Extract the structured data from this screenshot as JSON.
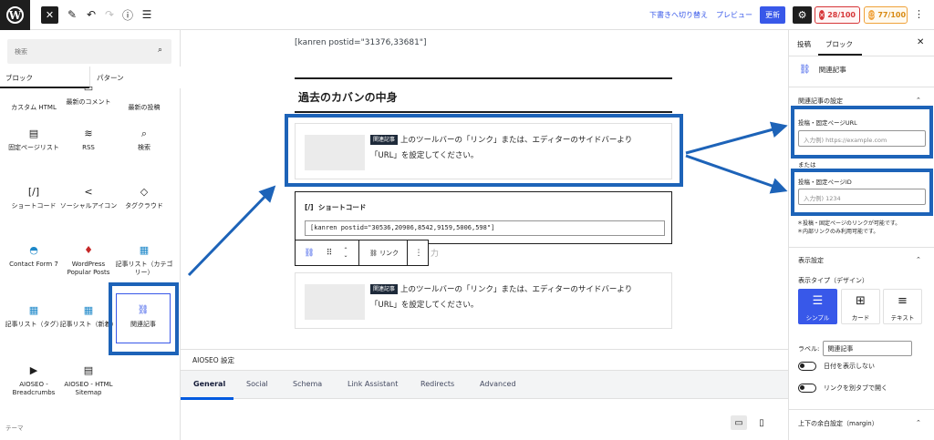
{
  "topbar": {
    "close_icon": "close-icon",
    "edit_icon": "pen-icon",
    "undo_icon": "undo-icon",
    "redo_icon": "redo-icon",
    "info_icon": "info-icon",
    "outline_icon": "list-view-icon",
    "switch_draft": "下書きへ切り替え",
    "preview": "プレビュー",
    "update": "更新",
    "score_seo": "28/100",
    "score_readability": "77/100"
  },
  "inserter": {
    "search_placeholder": "検索",
    "tab_blocks": "ブロック",
    "tab_patterns": "パターン",
    "footer": "テーマ",
    "blocks": [
      {
        "label": "カスタム HTML",
        "icon": "html-icon"
      },
      {
        "label": "最新のコメント",
        "icon": "comment-icon"
      },
      {
        "label": "最新の投稿",
        "icon": "posts-icon"
      },
      {
        "label": "固定ページリスト",
        "icon": "page-list-icon"
      },
      {
        "label": "RSS",
        "icon": "rss-icon"
      },
      {
        "label": "検索",
        "icon": "search-icon"
      },
      {
        "label": "ショートコード",
        "icon": "shortcode-icon"
      },
      {
        "label": "ソーシャルアイコン",
        "icon": "share-icon"
      },
      {
        "label": "タグクラウド",
        "icon": "tag-icon"
      },
      {
        "label": "Contact Form 7",
        "icon": "contact-form-icon"
      },
      {
        "label": "WordPress Popular Posts",
        "icon": "flame-icon"
      },
      {
        "label": "記事リスト（カテゴリー）",
        "icon": "article-list-icon"
      },
      {
        "label": "記事リスト（タグ）",
        "icon": "article-list-icon"
      },
      {
        "label": "記事リスト（新着）",
        "icon": "article-list-icon"
      },
      {
        "label": "関連記事",
        "icon": "link-icon"
      },
      {
        "label": "AIOSEO - Breadcrumbs",
        "icon": "breadcrumbs-icon"
      },
      {
        "label": "AIOSEO - HTML Sitemap",
        "icon": "sitemap-icon"
      }
    ]
  },
  "editor": {
    "shortcode_top": "[kanren postid=\"31376,33681\"]",
    "heading": "過去のカバンの中身",
    "badge": "関連記事",
    "card_text": "上のツールバーの「リンク」または、エディターのサイドバーより「URL」を設定してください。",
    "shortcode_label": "ショートコード",
    "shortcode_value": "[kanren postid=\"30536,20906,8542,9159,5006,598\"]",
    "toolbar_link": "リンク",
    "ghost_text": "力"
  },
  "aioseo": {
    "title": "AIOSEO 設定",
    "tabs": [
      "General",
      "Social",
      "Schema",
      "Link Assistant",
      "Redirects",
      "Advanced"
    ]
  },
  "sidebar": {
    "tab_post": "投稿",
    "tab_block": "ブロック",
    "block_name": "関連記事",
    "section_settings": "関連記事の設定",
    "url_label": "投稿・固定ページURL",
    "url_placeholder": "入力例) https://example.com",
    "or": "または",
    "id_label": "投稿・固定ページID",
    "id_placeholder": "入力例) 1234",
    "note1": "＊投稿・固定ページのリンクが可能です。",
    "note2": "＊内部リンクのみ利用可能です。",
    "section_display": "表示設定",
    "display_type": "表示タイプ（デザイン）",
    "style_simple": "シンプル",
    "style_card": "カード",
    "style_text": "テキスト",
    "label_title": "ラベル:",
    "label_value": "関連記事",
    "toggle_date": "日付を表示しない",
    "toggle_newtab": "リンクを別タブで開く",
    "section_margin": "上下の余白設定（margin）"
  },
  "colors": {
    "accent": "#3858e9",
    "annotation": "#1d63b8",
    "aioseo_active": "#005ae0"
  }
}
